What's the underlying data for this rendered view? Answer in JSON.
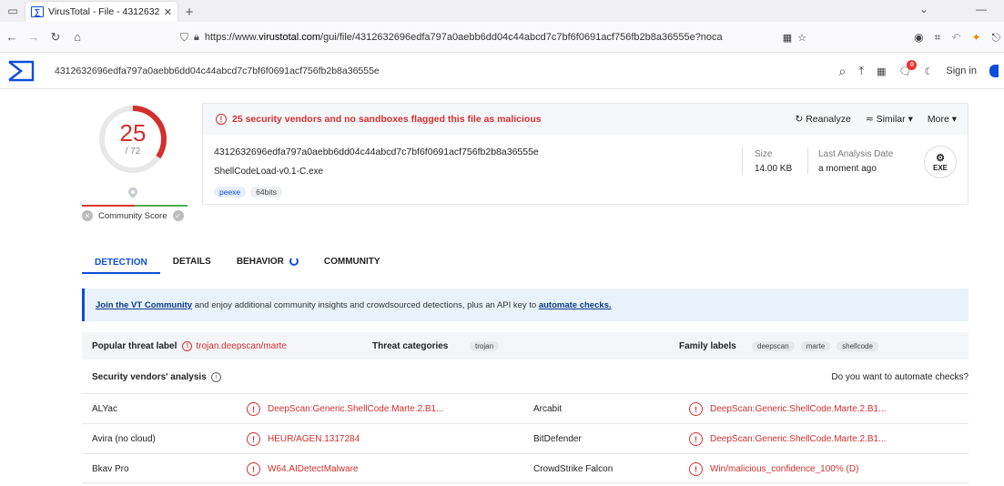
{
  "browser": {
    "tab_title": "VirusTotal - File - 43126326",
    "url_prefix": "https://www.",
    "url_domain": "virustotal.com",
    "url_suffix": "/gui/file/4312632696edfa797a0aebb6dd04c44abcd7c7bf6f0691acf756fb2b8a36555e?noca"
  },
  "header": {
    "hash": "4312632696edfa797a0aebb6dd04c44abcd7c7bf6f0691acf756fb2b8a36555e",
    "signin": "Sign in",
    "notification_count": "0"
  },
  "score": {
    "detected": "25",
    "total": "/ 72",
    "community_label": "Community Score",
    "ratio": 0.347
  },
  "summary": {
    "flag_text": "25 security vendors and no sandboxes flagged this file as malicious",
    "reanalyze": "Reanalyze",
    "similar": "Similar",
    "more": "More",
    "hash": "4312632696edfa797a0aebb6dd04c44abcd7c7bf6f0691acf756fb2b8a36555e",
    "filename": "ShellCodeLoad-v0.1-C.exe",
    "tags": [
      "peexe",
      "64bits"
    ],
    "size_label": "Size",
    "size_value": "14.00 KB",
    "analysis_label": "Last Analysis Date",
    "analysis_value": "a moment ago",
    "file_type": "EXE"
  },
  "tabs": [
    "DETECTION",
    "DETAILS",
    "BEHAVIOR",
    "COMMUNITY"
  ],
  "banner": {
    "link1": "Join the VT Community",
    "text": " and enjoy additional community insights and crowdsourced detections, plus an API key to ",
    "link2": "automate checks."
  },
  "threat": {
    "popular_label": "Popular threat label",
    "popular_value": "trojan.deepscan/marte",
    "categories_label": "Threat categories",
    "categories": [
      "trojan"
    ],
    "family_label": "Family labels",
    "families": [
      "deepscan",
      "marte",
      "shellcode"
    ]
  },
  "vendors_section": {
    "title": "Security vendors' analysis",
    "automate": "Do you want to automate checks?"
  },
  "vendors": [
    {
      "name": "ALYac",
      "result": "DeepScan:Generic.ShellCode.Marte.2.B1...",
      "name2": "Arcabit",
      "result2": "DeepScan:Generic.ShellCode.Marte.2.B1..."
    },
    {
      "name": "Avira (no cloud)",
      "result": "HEUR/AGEN.1317284",
      "name2": "BitDefender",
      "result2": "DeepScan:Generic.ShellCode.Marte.2.B1..."
    },
    {
      "name": "Bkav Pro",
      "result": "W64.AIDetectMalware",
      "name2": "CrowdStrike Falcon",
      "result2": "Win/malicious_confidence_100% (D)"
    }
  ]
}
